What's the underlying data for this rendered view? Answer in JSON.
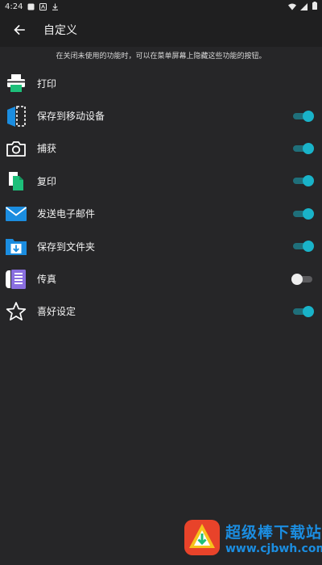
{
  "status_bar": {
    "time": "4:24"
  },
  "toolbar": {
    "title": "自定义"
  },
  "info": {
    "text": "在关闭未使用的功能时，可以在菜单屏幕上隐藏这些功能的按钮。"
  },
  "items": [
    {
      "label": "打印",
      "icon": "printer-icon",
      "has_toggle": false
    },
    {
      "label": "保存到移动设备",
      "icon": "save-to-device-icon",
      "has_toggle": true,
      "on": true
    },
    {
      "label": "捕获",
      "icon": "camera-icon",
      "has_toggle": true,
      "on": true
    },
    {
      "label": "复印",
      "icon": "copy-icon",
      "has_toggle": true,
      "on": true
    },
    {
      "label": "发送电子邮件",
      "icon": "envelope-icon",
      "has_toggle": true,
      "on": true
    },
    {
      "label": "保存到文件夹",
      "icon": "folder-download-icon",
      "has_toggle": true,
      "on": true
    },
    {
      "label": "传真",
      "icon": "fax-icon",
      "has_toggle": true,
      "on": false
    },
    {
      "label": "喜好设定",
      "icon": "star-icon",
      "has_toggle": true,
      "on": true
    }
  ],
  "watermark": {
    "title": "超级棒下载站",
    "url": "www.cjbwh.com"
  },
  "colors": {
    "accent": "#19b3c9",
    "background": "#262628",
    "icon_green": "#1dbf7a",
    "icon_blue": "#1b8de0"
  }
}
